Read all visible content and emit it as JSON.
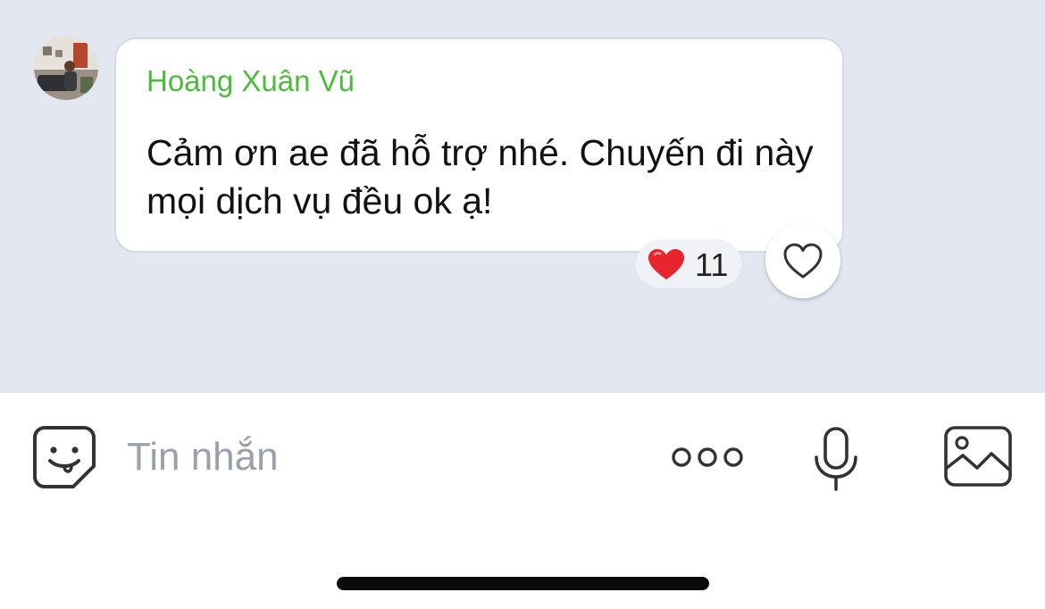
{
  "message": {
    "sender_name": "Hoàng Xuân Vũ",
    "text": "Cảm ơn ae đã hỗ trợ nhé. Chuyến đi này mọi dịch vụ đều ok ạ!",
    "reaction": {
      "icon": "red-heart-icon",
      "count": "11"
    },
    "like_icon": "heart-outline-icon"
  },
  "composer": {
    "placeholder": "Tin nhắn",
    "icons": [
      "sticker-icon",
      "more-dots-icon",
      "microphone-icon",
      "image-icon"
    ]
  },
  "colors": {
    "chat_background": "#e2e7ef",
    "sender_name": "#4cbb3c",
    "icon_stroke": "#333333",
    "placeholder": "#9aa1ab",
    "reaction_heart": "#e8252f"
  }
}
